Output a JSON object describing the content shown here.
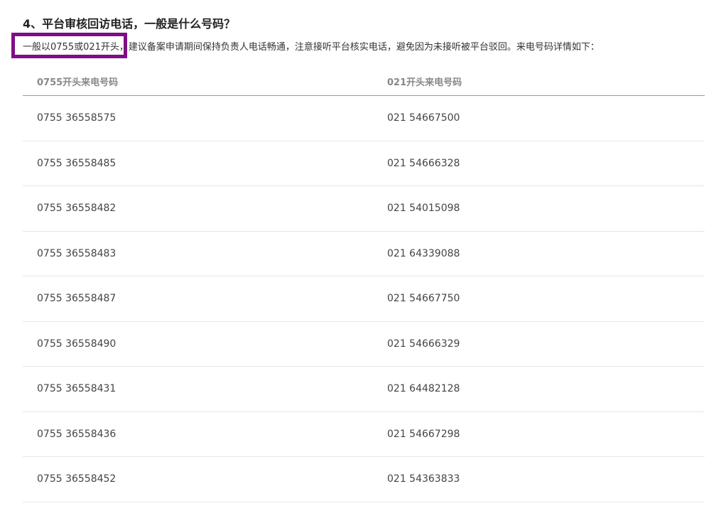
{
  "heading": "4、平台审核回访电话，一般是什么号码？",
  "intro": {
    "highlighted": "一般以0755或021开头，",
    "rest": "建议备案申请期间保持负责人电话畅通，注意接听平台核实电话，避免因为未接听被平台驳回。来电号码详情如下："
  },
  "highlight_color": "#800d86",
  "table": {
    "headers": [
      "0755开头来电号码",
      "021开头来电号码"
    ],
    "rows": [
      [
        "0755 36558575",
        "021 54667500"
      ],
      [
        "0755 36558485",
        "021 54666328"
      ],
      [
        "0755 36558482",
        "021 54015098"
      ],
      [
        "0755 36558483",
        "021 64339088"
      ],
      [
        "0755 36558487",
        "021 54667750"
      ],
      [
        "0755 36558490",
        "021 54666329"
      ],
      [
        "0755 36558431",
        "021 64482128"
      ],
      [
        "0755 36558436",
        "021 54667298"
      ],
      [
        "0755 36558452",
        "021 54363833"
      ]
    ]
  }
}
